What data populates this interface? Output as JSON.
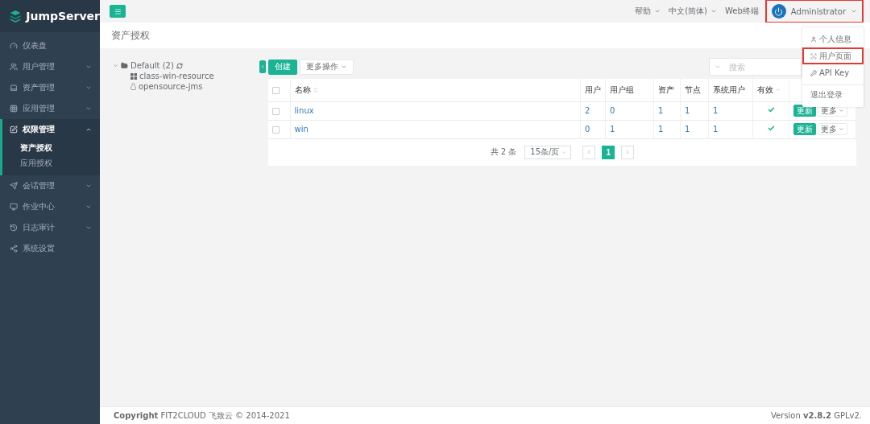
{
  "brand": "JumpServer",
  "sidebar": {
    "items": [
      {
        "label": "仪表盘",
        "kind": "link"
      },
      {
        "label": "用户管理",
        "kind": "group",
        "expanded": false
      },
      {
        "label": "资产管理",
        "kind": "group",
        "expanded": false
      },
      {
        "label": "应用管理",
        "kind": "group",
        "expanded": false
      },
      {
        "label": "权限管理",
        "kind": "group",
        "expanded": true,
        "children": [
          {
            "label": "资产授权",
            "selected": true
          },
          {
            "label": "应用授权",
            "selected": false
          }
        ]
      },
      {
        "label": "会话管理",
        "kind": "group",
        "expanded": false
      },
      {
        "label": "作业中心",
        "kind": "group",
        "expanded": false
      },
      {
        "label": "日志审计",
        "kind": "group",
        "expanded": false
      },
      {
        "label": "系统设置",
        "kind": "link"
      }
    ]
  },
  "topbar": {
    "links": [
      {
        "label": "帮助",
        "dropdown": true
      },
      {
        "label": "中文(简体)",
        "dropdown": true
      },
      {
        "label": "Web终端",
        "dropdown": false
      }
    ],
    "user": {
      "name": "Administrator",
      "highlighted": true
    },
    "user_menu": [
      {
        "label": "个人信息",
        "highlighted": false,
        "separated": false
      },
      {
        "label": "用户页面",
        "highlighted": true,
        "separated": false
      },
      {
        "label": "API Key",
        "highlighted": false,
        "separated": false
      },
      {
        "label": "退出登录",
        "highlighted": false,
        "separated": true
      }
    ]
  },
  "page_title": "资产授权",
  "tree": {
    "label": "Default (2)",
    "expanded": true,
    "children": [
      {
        "label": "class-win-resource",
        "kind": "windows"
      },
      {
        "label": "opensource-jms",
        "kind": "linux"
      }
    ]
  },
  "toolbar": {
    "create": "创建",
    "more": "更多操作",
    "search_placeholder": "搜索"
  },
  "table": {
    "select_all": false,
    "columns": [
      "名称",
      "用户",
      "用户组",
      "资产",
      "节点",
      "系统用户",
      "有效"
    ],
    "rows": [
      {
        "checked": false,
        "name": "linux",
        "users": "2",
        "user_groups": "0",
        "assets": "1",
        "nodes": "1",
        "system_users": "1",
        "valid": true,
        "actions": [
          "更新",
          "更多"
        ]
      },
      {
        "checked": false,
        "name": "win",
        "users": "0",
        "user_groups": "1",
        "assets": "1",
        "nodes": "1",
        "system_users": "1",
        "valid": true,
        "actions": [
          "更新",
          "更多"
        ]
      }
    ]
  },
  "pagination": {
    "total": "共 2 条",
    "page_size": "15条/页",
    "pages": [
      {
        "label": "1",
        "selected": true
      }
    ]
  },
  "footer": {
    "copyright": "**Copyright** FIT2CLOUD 飞致云 © 2014-2021",
    "version": "Version **v2.8.2** GPLv2."
  }
}
